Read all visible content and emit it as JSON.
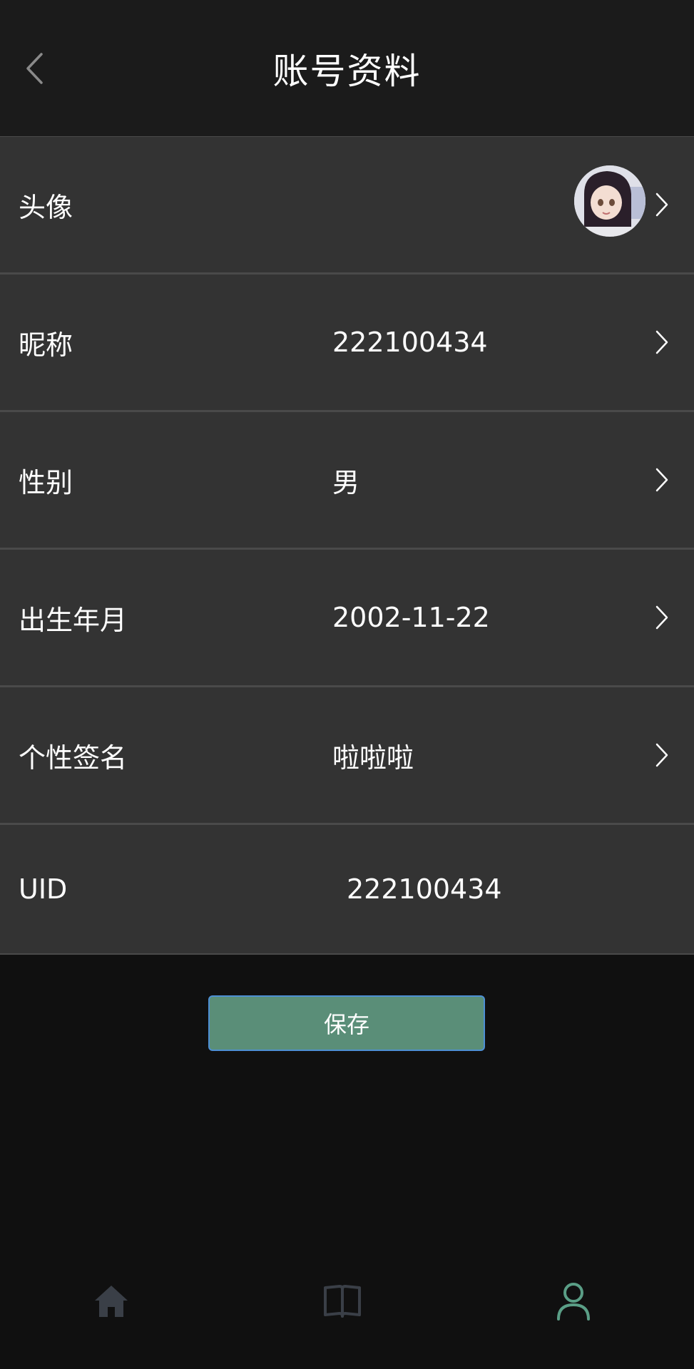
{
  "header": {
    "title": "账号资料",
    "back_icon": "chevron-left-icon"
  },
  "profile": {
    "avatar": {
      "label": "头像"
    },
    "nickname": {
      "label": "昵称",
      "value": "222100434"
    },
    "gender": {
      "label": "性别",
      "value": "男"
    },
    "birthday": {
      "label": "出生年月",
      "value": "2002-11-22"
    },
    "signature": {
      "label": "个性签名",
      "value": "啦啦啦"
    },
    "uid": {
      "label": "UID",
      "value": "222100434"
    }
  },
  "actions": {
    "save_label": "保存"
  },
  "bottom_nav": {
    "items": [
      {
        "icon": "home-icon",
        "active": false
      },
      {
        "icon": "book-icon",
        "active": false
      },
      {
        "icon": "user-icon",
        "active": true
      }
    ]
  },
  "colors": {
    "header_bg": "#1b1b1b",
    "row_bg": "#333333",
    "page_bg": "#101010",
    "save_button_bg": "#5a8e78",
    "save_button_border": "#4d8fd4",
    "nav_inactive": "#3a3f47",
    "nav_active": "#5a9e86"
  }
}
